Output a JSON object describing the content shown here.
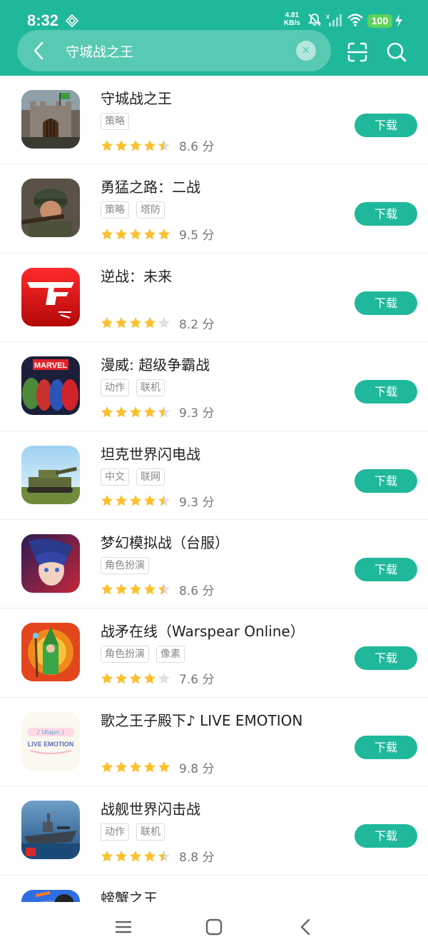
{
  "status_bar": {
    "time": "8:32",
    "net_speed_value": "4.81",
    "net_speed_unit": "KB/s",
    "battery": "100"
  },
  "search": {
    "query": "守城战之王",
    "placeholder": ""
  },
  "colors": {
    "accent": "#1fb89a",
    "star": "#fbc02d",
    "star_empty": "#e0e0e0"
  },
  "download_label": "下载",
  "score_unit": "分",
  "apps": [
    {
      "name": "守城战之王",
      "tags": [
        "策略"
      ],
      "stars": 4.5,
      "score": "8.6"
    },
    {
      "name": "勇猛之路：二战",
      "tags": [
        "策略",
        "塔防"
      ],
      "stars": 5,
      "score": "9.5"
    },
    {
      "name": "逆战：未来",
      "tags": [],
      "stars": 4,
      "score": "8.2"
    },
    {
      "name": "漫威: 超级争霸战",
      "tags": [
        "动作",
        "联机"
      ],
      "stars": 4.5,
      "score": "9.3"
    },
    {
      "name": "坦克世界闪电战",
      "tags": [
        "中文",
        "联网"
      ],
      "stars": 4.5,
      "score": "9.3"
    },
    {
      "name": "梦幻模拟战（台服）",
      "tags": [
        "角色扮演"
      ],
      "stars": 4.5,
      "score": "8.6"
    },
    {
      "name": "战矛在线（Warspear Online）",
      "tags": [
        "角色扮演",
        "像素"
      ],
      "stars": 4,
      "score": "7.6"
    },
    {
      "name": "歌之王子殿下♪ LIVE EMOTION",
      "tags": [],
      "stars": 5,
      "score": "9.8"
    },
    {
      "name": "战舰世界闪击战",
      "tags": [
        "动作",
        "联机"
      ],
      "stars": 4.5,
      "score": "8.8"
    },
    {
      "name": "螃蟹之王",
      "tags": [],
      "stars": 0,
      "score": ""
    }
  ]
}
